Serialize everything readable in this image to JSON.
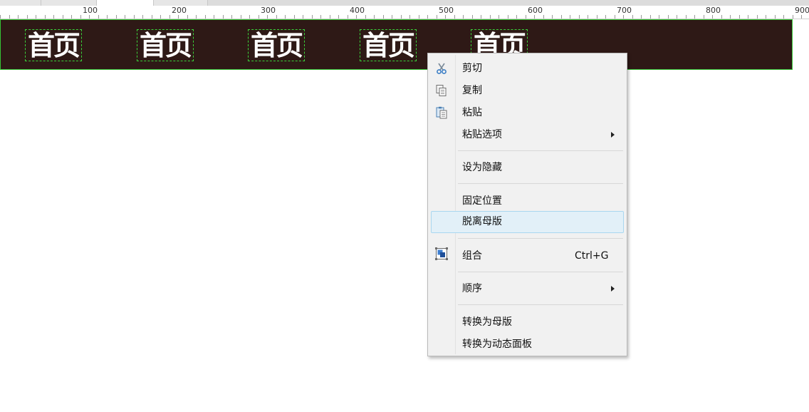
{
  "colors": {
    "navbar_bg": "#2e1916",
    "navbar_border": "#35c435",
    "nav_item_outline": "#3ad23a",
    "menu_hover_bg": "#e2f0f8",
    "menu_hover_border": "#a9d7f0"
  },
  "ruler": {
    "labels": [
      "100",
      "200",
      "300",
      "400",
      "500",
      "600",
      "700",
      "800",
      "900"
    ]
  },
  "navbar": {
    "items": [
      {
        "label": "首页"
      },
      {
        "label": "首页"
      },
      {
        "label": "首页"
      },
      {
        "label": "首页"
      },
      {
        "label": "首页"
      }
    ]
  },
  "context_menu": {
    "cut": {
      "label": "剪切",
      "icon": "scissors-icon"
    },
    "copy": {
      "label": "复制",
      "icon": "copy-icon"
    },
    "paste": {
      "label": "粘贴",
      "icon": "paste-icon"
    },
    "paste_options": {
      "label": "粘贴选项",
      "submenu": true
    },
    "set_hidden": {
      "label": "设为隐藏"
    },
    "fix_position": {
      "label": "固定位置"
    },
    "detach_master": {
      "label": "脱离母版",
      "highlighted": true
    },
    "group": {
      "label": "组合",
      "shortcut": "Ctrl+G",
      "icon": "group-icon"
    },
    "order": {
      "label": "顺序",
      "submenu": true
    },
    "convert_master": {
      "label": "转换为母版"
    },
    "convert_dynamic_panel": {
      "label": "转换为动态面板"
    }
  }
}
